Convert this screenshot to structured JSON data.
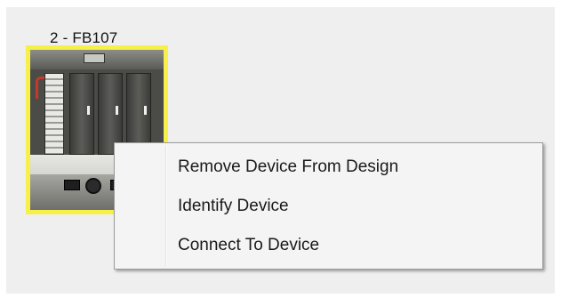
{
  "device": {
    "label": "2 - FB107",
    "image_icon": "fb107-device-icon",
    "selection_color": "#f7ef4a"
  },
  "context_menu": {
    "items": [
      {
        "label": "Remove Device From Design"
      },
      {
        "label": "Identify Device"
      },
      {
        "label": "Connect To Device"
      }
    ]
  }
}
